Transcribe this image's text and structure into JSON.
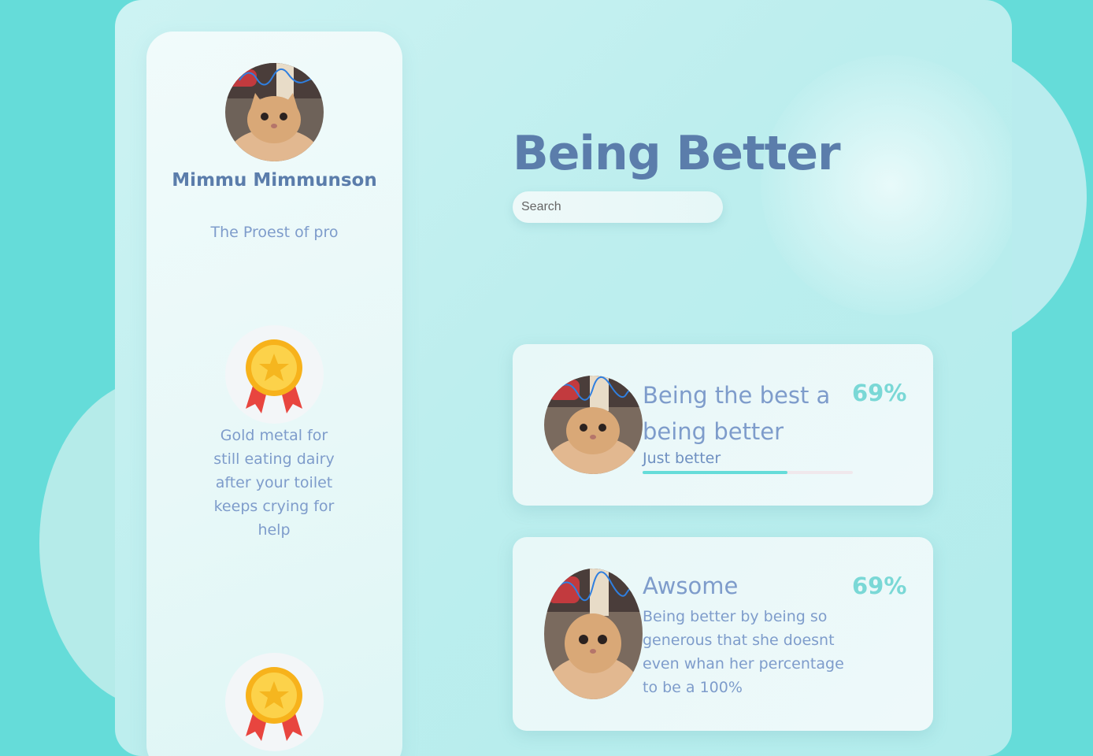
{
  "profile": {
    "name": "Mimmu Mimmunson",
    "title": "The Proest of pro",
    "avatar_icon": "cat-photo-avatar"
  },
  "badges": [
    {
      "icon": "gold-medal-icon",
      "text": "Gold metal for still eating dairy after your toilet keeps crying for help"
    },
    {
      "icon": "gold-medal-icon"
    }
  ],
  "page": {
    "title": "Being Better",
    "search_placeholder": "Search"
  },
  "cards": [
    {
      "title": "Being the best a being better",
      "percent": "69%",
      "subtitle": "Just better",
      "progress": 0.69,
      "image_icon": "cat-photo"
    },
    {
      "title": "Awsome",
      "percent": "69%",
      "description": "Being better by being so generous that she doesnt even whan her percentage to be a 100%",
      "image_icon": "cat-photo"
    }
  ],
  "colors": {
    "background": "#65dcd9",
    "heading": "#5b7dab",
    "text": "#7e9ccb",
    "accent": "#7ad8d6",
    "progress": "#65dcd9"
  }
}
